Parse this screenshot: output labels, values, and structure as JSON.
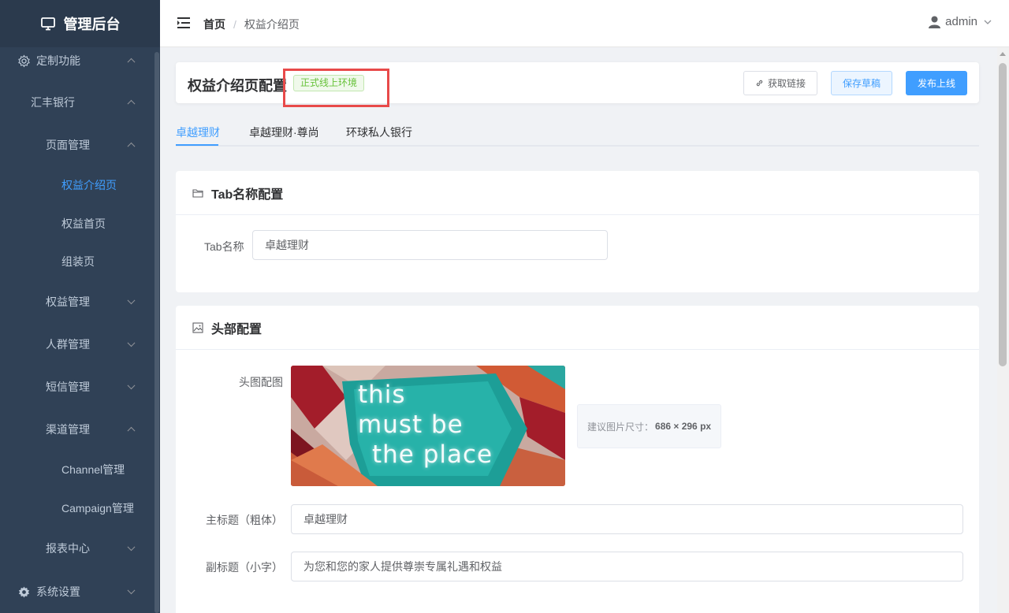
{
  "app": {
    "title": "管理后台"
  },
  "sidebar": {
    "items": [
      {
        "label": "定制功能"
      },
      {
        "label": "汇丰银行"
      },
      {
        "label": "页面管理"
      },
      {
        "label": "权益介绍页"
      },
      {
        "label": "权益首页"
      },
      {
        "label": "组装页"
      },
      {
        "label": "权益管理"
      },
      {
        "label": "人群管理"
      },
      {
        "label": "短信管理"
      },
      {
        "label": "渠道管理"
      },
      {
        "label": "Channel管理"
      },
      {
        "label": "Campaign管理"
      },
      {
        "label": "报表中心"
      },
      {
        "label": "系统设置"
      }
    ]
  },
  "header": {
    "breadcrumb": {
      "home": "首页",
      "separator": "/",
      "current": "权益介绍页"
    },
    "user": "admin"
  },
  "page": {
    "title": "权益介绍页配置",
    "env_tag": "正式线上环境",
    "buttons": {
      "link": "获取链接",
      "draft": "保存草稿",
      "publish": "发布上线"
    }
  },
  "tabs": [
    {
      "label": "卓越理财"
    },
    {
      "label": "卓越理财·尊尚"
    },
    {
      "label": "环球私人银行"
    }
  ],
  "tab_section": {
    "title": "Tab名称配置",
    "label": "Tab名称",
    "value": "卓越理财"
  },
  "header_section": {
    "title": "头部配置",
    "image_label": "头图配图",
    "image_text": [
      "this",
      "must be",
      "the place"
    ],
    "size_hint_label": "建议图片尺寸：",
    "size_hint_value": "686 × 296 px",
    "main_title_label": "主标题（粗体）",
    "main_title_value": "卓越理财",
    "subtitle_label": "副标题（小字）",
    "subtitle_value": "为您和您的家人提供尊崇专属礼遇和权益"
  },
  "colors": {
    "accent": "#409eff",
    "sidebar_bg": "#304156",
    "success": "#67c23a",
    "highlight": "#e84a4a"
  }
}
